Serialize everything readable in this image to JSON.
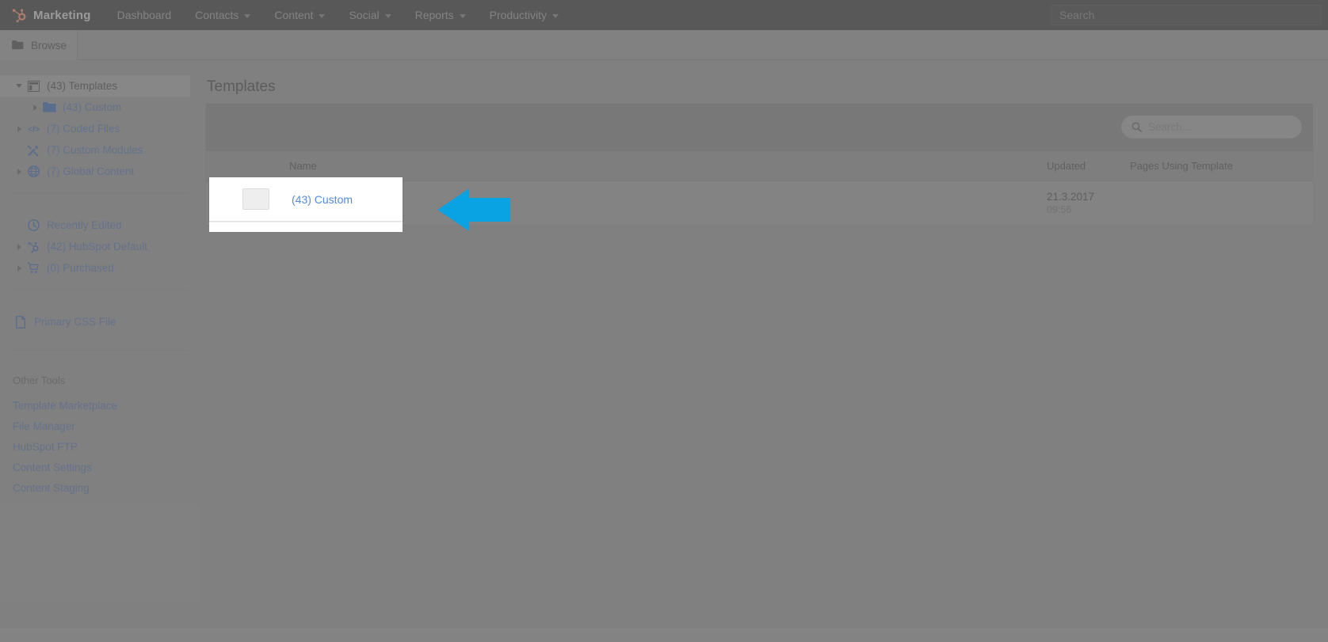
{
  "topnav": {
    "brand": "Marketing",
    "items": [
      {
        "label": "Dashboard",
        "has_caret": false
      },
      {
        "label": "Contacts",
        "has_caret": true
      },
      {
        "label": "Content",
        "has_caret": true
      },
      {
        "label": "Social",
        "has_caret": true
      },
      {
        "label": "Reports",
        "has_caret": true
      },
      {
        "label": "Productivity",
        "has_caret": true
      }
    ],
    "search_placeholder": "Search"
  },
  "tabbar": {
    "browse_label": "Browse"
  },
  "sidebar": {
    "tree": [
      {
        "label": "(43) Templates",
        "icon": "template-icon",
        "twisty": "down",
        "level": 0,
        "selected": true
      },
      {
        "label": "(43) Custom",
        "icon": "folder-icon",
        "twisty": "right",
        "level": 1,
        "selected": false
      },
      {
        "label": "(7) Coded Files",
        "icon": "code-icon",
        "twisty": "right",
        "level": 0,
        "selected": false
      },
      {
        "label": "(7) Custom Modules",
        "icon": "tools-icon",
        "twisty": "none",
        "level": 0,
        "selected": false
      },
      {
        "label": "(7) Global Content",
        "icon": "globe-icon",
        "twisty": "right",
        "level": 0,
        "selected": false
      }
    ],
    "tree2": [
      {
        "label": "Recently Edited",
        "icon": "clock-icon",
        "twisty": "none"
      },
      {
        "label": "(42) HubSpot Default",
        "icon": "sprocket-icon",
        "twisty": "right"
      },
      {
        "label": "(0) Purchased",
        "icon": "cart-icon",
        "twisty": "right"
      }
    ],
    "css_file": {
      "label": "Primary CSS File",
      "icon": "document-icon"
    },
    "other_tools_title": "Other Tools",
    "other_tools": [
      "Template Marketplace",
      "File Manager",
      "HubSpot FTP",
      "Content Settings",
      "Content Staging"
    ]
  },
  "main": {
    "page_title": "Templates",
    "table_search_placeholder": "Search...",
    "columns": {
      "name": "Name",
      "updated": "Updated",
      "pages_using_template": "Pages Using Template"
    },
    "rows": [
      {
        "name": "(43) Custom",
        "icon": "folder-icon",
        "updated_date": "21.3.2017",
        "updated_time": "09:56",
        "pages_using_template": ""
      }
    ]
  },
  "annotation": {
    "highlight_name": "(43) Custom",
    "arrow_direction": "left",
    "arrow_color": "#09a2e3",
    "highlight_color": "#ffffff"
  }
}
